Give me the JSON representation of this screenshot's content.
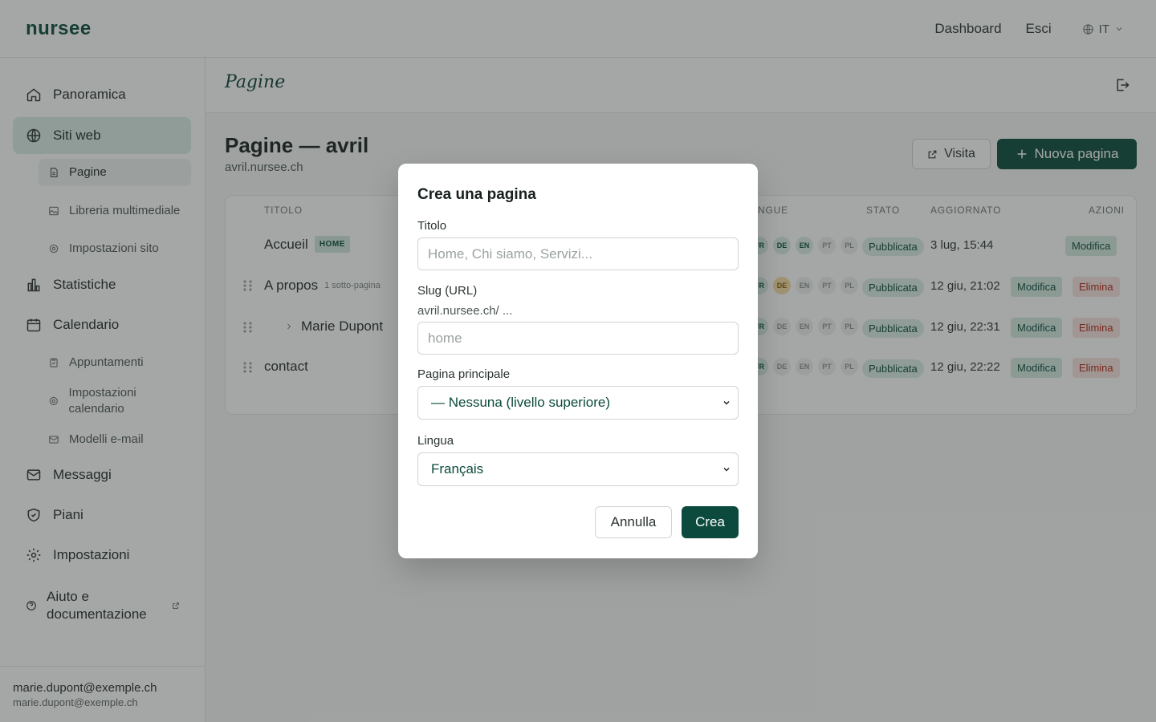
{
  "topbar": {
    "logo": "nursee",
    "nav": [
      "Dashboard",
      "Esci"
    ],
    "language": "IT"
  },
  "sidebar": {
    "items": [
      {
        "label": "Panoramica",
        "icon": "home-icon"
      },
      {
        "label": "Siti web",
        "icon": "globe-icon",
        "active": true
      },
      {
        "label": "Statistiche",
        "icon": "chart-icon"
      },
      {
        "label": "Calendario",
        "icon": "calendar-icon"
      },
      {
        "label": "Messaggi",
        "icon": "mail-icon"
      },
      {
        "label": "Piani",
        "icon": "shield-icon"
      },
      {
        "label": "Impostazioni",
        "icon": "gear-icon"
      },
      {
        "label": "Aiuto e documentazione",
        "icon": "help-icon"
      }
    ],
    "site_sub": [
      {
        "label": "Pagine",
        "icon": "page-icon",
        "active": true
      },
      {
        "label": "Libreria multimediale",
        "icon": "image-icon"
      },
      {
        "label": "Impostazioni sito",
        "icon": "gear-icon"
      }
    ],
    "calendar_sub": [
      {
        "label": "Appuntamenti",
        "icon": "clipboard-icon"
      },
      {
        "label": "Impostazioni calendario",
        "icon": "gear-icon"
      },
      {
        "label": "Modelli e-mail",
        "icon": "mail-icon"
      }
    ],
    "user": {
      "name": "marie.dupont@exemple.ch",
      "email": "marie.dupont@exemple.ch"
    }
  },
  "header": {
    "title": "Pagine"
  },
  "main": {
    "heading": "Pagine — avril",
    "subdomain": "avril.nursee.ch",
    "visit_label": "Visita",
    "new_page_label": "Nuova pagina",
    "columns": {
      "title": "TITOLO",
      "languages": "NGUE",
      "status": "STATO",
      "updated": "AGGIORNATO",
      "actions": "AZIONI"
    },
    "rows": [
      {
        "title": "Accueil",
        "badge": "HOME",
        "langs": [
          "FR",
          "DE",
          "EN",
          "PT",
          "PL"
        ],
        "status": "Pubblicata",
        "updated": "3 lug, 15:44",
        "edit": "Modifica"
      },
      {
        "title": "A propos",
        "subcount": "1 sotto-pagina",
        "langs": [
          "FR",
          "DE",
          "EN",
          "PT",
          "PL"
        ],
        "status": "Pubblicata",
        "updated": "12 giu, 21:02",
        "edit": "Modifica",
        "delete": "Elimina"
      },
      {
        "title": "Marie Dupont",
        "langs": [
          "FR",
          "DE",
          "EN",
          "PT",
          "PL"
        ],
        "status": "Pubblicata",
        "updated": "12 giu, 22:31",
        "edit": "Modifica",
        "delete": "Elimina"
      },
      {
        "title": "contact",
        "langs": [
          "FR",
          "DE",
          "EN",
          "PT",
          "PL"
        ],
        "status": "Pubblicata",
        "updated": "12 giu, 22:22",
        "edit": "Modifica",
        "delete": "Elimina"
      }
    ]
  },
  "modal": {
    "title": "Crea una pagina",
    "title_label": "Titolo",
    "title_placeholder": "Home, Chi siamo, Servizi...",
    "slug_label": "Slug (URL)",
    "slug_prefix": "avril.nursee.ch/ ...",
    "slug_placeholder": "home",
    "parent_label": "Pagina principale",
    "parent_value": "— Nessuna (livello superiore)",
    "language_label": "Lingua",
    "language_value": "Français",
    "cancel_label": "Annulla",
    "create_label": "Crea"
  },
  "colors": {
    "brand": "#0b4a3c",
    "danger": "#b42318",
    "active_bg": "#d9ece5"
  }
}
